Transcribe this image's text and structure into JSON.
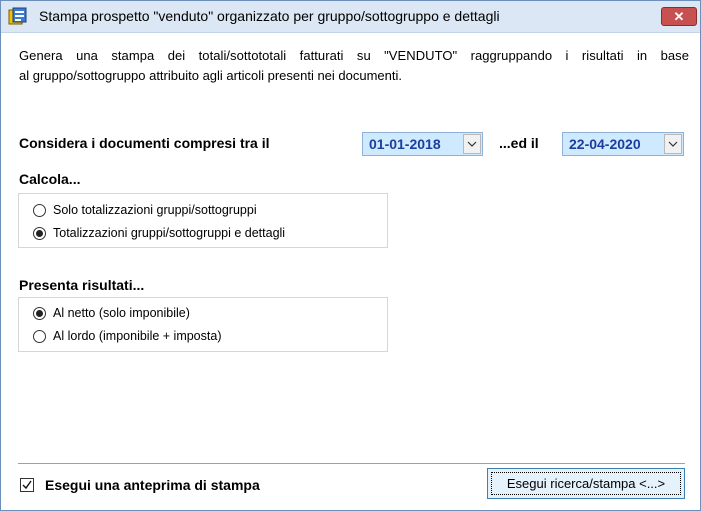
{
  "window": {
    "title": "Stampa prospetto \"venduto\" organizzato per gruppo/sottogruppo e dettagli",
    "close_label": "✕",
    "accent": "#c75050"
  },
  "description": {
    "line1": "Genera una stampa dei totali/sottototali fatturati su \"VENDUTO\" raggruppando i risultati in base",
    "line2": "al gruppo/sottogruppo attribuito agli articoli presenti nei documenti."
  },
  "date_range": {
    "label": "Considera i documenti compresi tra il",
    "from_value": "01-01-2018",
    "to_label": "...ed il",
    "to_value": "22-04-2020",
    "field_color": "#cfe9ff",
    "text_color": "#1a3f9e"
  },
  "calcola": {
    "title": "Calcola...",
    "options": [
      {
        "label": "Solo totalizzazioni gruppi/sottogruppi",
        "selected": false
      },
      {
        "label": "Totalizzazioni gruppi/sottogruppi e dettagli",
        "selected": true
      }
    ]
  },
  "presenta": {
    "title": "Presenta risultati...",
    "options": [
      {
        "label": "Al netto (solo imponibile)",
        "selected": true
      },
      {
        "label": "Al lordo (imponibile + imposta)",
        "selected": false
      }
    ]
  },
  "footer": {
    "preview_label": "Esegui una anteprima di stampa",
    "preview_checked": true,
    "action_label": "Esegui ricerca/stampa <...>"
  },
  "icons": [
    "app-icon",
    "close-icon",
    "chevron-down-icon",
    "checkmark-icon"
  ]
}
